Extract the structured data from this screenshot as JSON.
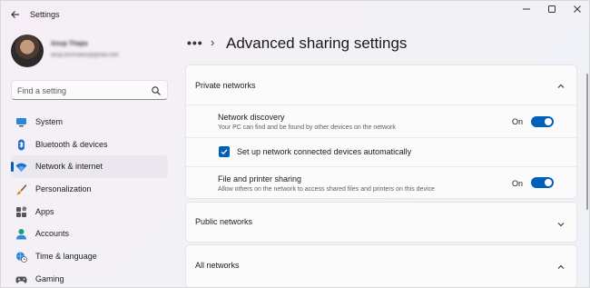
{
  "window": {
    "title": "Settings",
    "back_icon": "back-arrow-icon",
    "controls": [
      "minimize-icon",
      "maximize-icon",
      "close-icon"
    ]
  },
  "user": {
    "name": "Anup Thapa",
    "email": "anup.techviews@gmail.com"
  },
  "search": {
    "placeholder": "Find a setting",
    "icon": "search-icon"
  },
  "sidebar": {
    "items": [
      {
        "label": "System",
        "icon": "monitor-icon",
        "selected": false
      },
      {
        "label": "Bluetooth & devices",
        "icon": "bluetooth-icon",
        "selected": false
      },
      {
        "label": "Network & internet",
        "icon": "wifi-icon",
        "selected": true
      },
      {
        "label": "Personalization",
        "icon": "brush-icon",
        "selected": false
      },
      {
        "label": "Apps",
        "icon": "apps-icon",
        "selected": false
      },
      {
        "label": "Accounts",
        "icon": "account-icon",
        "selected": false
      },
      {
        "label": "Time & language",
        "icon": "globe-clock-icon",
        "selected": false
      },
      {
        "label": "Gaming",
        "icon": "gamepad-icon",
        "selected": false
      }
    ]
  },
  "header": {
    "more": "•••",
    "chevron": "›",
    "title": "Advanced sharing settings"
  },
  "main": {
    "private": {
      "title": "Private networks",
      "expanded": true,
      "network_discovery": {
        "title": "Network discovery",
        "description": "Your PC can find and be found by other devices on the network",
        "toggle_label": "On",
        "toggle_on": true
      },
      "auto_setup": {
        "label": "Set up network connected devices automatically",
        "checked": true
      },
      "file_sharing": {
        "title": "File and printer sharing",
        "description": "Allow others on the network to access shared files and printers on this device",
        "toggle_label": "On",
        "toggle_on": true
      }
    },
    "public": {
      "title": "Public networks",
      "expanded": false
    },
    "all": {
      "title": "All networks",
      "expanded": true
    }
  },
  "colors": {
    "accent": "#005fb8",
    "selected_nav_bg": "#ebe7ee",
    "card_bg": "#fbfbfb"
  }
}
